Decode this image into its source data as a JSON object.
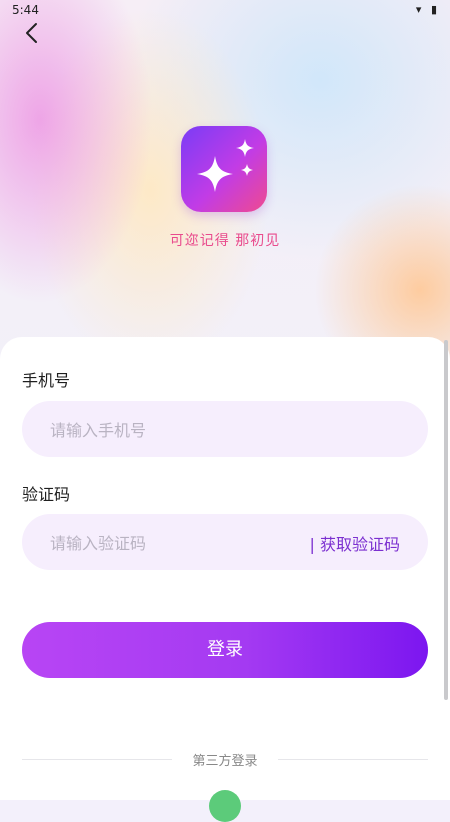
{
  "status_bar": {
    "time": "5:44",
    "icons": "▾ ▮"
  },
  "header": {
    "back_icon": "chevron-left-icon"
  },
  "app": {
    "icon": "sparkle-icon",
    "slogan": "可迩记得 那初见"
  },
  "form": {
    "phone_label": "手机号",
    "phone_placeholder": "请输入手机号",
    "code_label": "验证码",
    "code_placeholder": "请输入验证码",
    "get_code_label": "| 获取验证码",
    "login_label": "登录"
  },
  "third_party": {
    "label": "第三方登录",
    "icon": "wechat-icon"
  },
  "colors": {
    "accent": "#a43af2",
    "slogan": "#e94b8d",
    "input_bg": "#f6eefd"
  }
}
